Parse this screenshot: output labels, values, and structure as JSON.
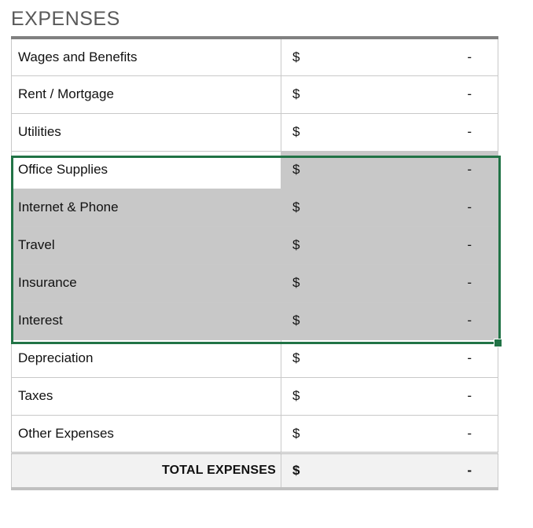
{
  "section": {
    "title": "EXPENSES"
  },
  "colors": {
    "title_text": "#595959",
    "top_rule": "#808080",
    "grid_line": "#c9c9c9",
    "selection_border": "#217346",
    "selection_fill": "#c8c8c8",
    "total_row_background": "#f2f2f2",
    "total_row_bottom_border": "#c0c0c0"
  },
  "table": {
    "currency_symbol": "$",
    "empty_value": "-",
    "rows": [
      {
        "label": "Wages and Benefits",
        "currency": "$",
        "value": "-",
        "selected": false,
        "active": false
      },
      {
        "label": "Rent / Mortgage",
        "currency": "$",
        "value": "-",
        "selected": false,
        "active": false
      },
      {
        "label": "Utilities",
        "currency": "$",
        "value": "-",
        "selected": false,
        "active": false
      },
      {
        "label": "Office Supplies",
        "currency": "$",
        "value": "-",
        "selected": true,
        "active": true
      },
      {
        "label": "Internet & Phone",
        "currency": "$",
        "value": "-",
        "selected": true,
        "active": false
      },
      {
        "label": "Travel",
        "currency": "$",
        "value": "-",
        "selected": true,
        "active": false
      },
      {
        "label": "Insurance",
        "currency": "$",
        "value": "-",
        "selected": true,
        "active": false
      },
      {
        "label": "Interest",
        "currency": "$",
        "value": "-",
        "selected": true,
        "active": false
      },
      {
        "label": "Depreciation",
        "currency": "$",
        "value": "-",
        "selected": false,
        "active": false
      },
      {
        "label": "Taxes",
        "currency": "$",
        "value": "-",
        "selected": false,
        "active": false
      },
      {
        "label": "Other Expenses",
        "currency": "$",
        "value": "-",
        "selected": false,
        "active": false
      }
    ],
    "total": {
      "label": "TOTAL EXPENSES",
      "currency": "$",
      "value": "-"
    }
  },
  "selection": {
    "first_row_label": "Office Supplies",
    "last_row_label": "Interest",
    "row_count": 5
  }
}
